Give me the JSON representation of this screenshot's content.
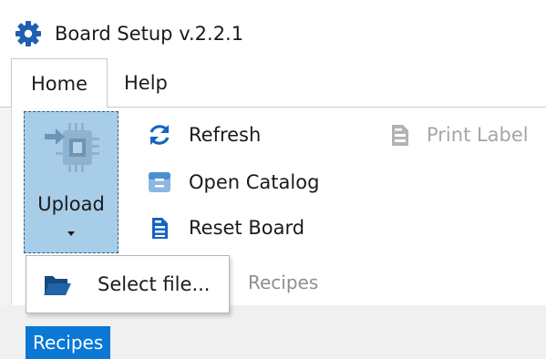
{
  "window": {
    "title": "Board Setup v.2.2.1",
    "icon": "gear-icon"
  },
  "menu": {
    "tabs": [
      {
        "label": "Home",
        "active": true
      },
      {
        "label": "Help",
        "active": false
      }
    ]
  },
  "ribbon": {
    "upload": {
      "label": "Upload",
      "icon": "chip-upload-icon",
      "pressed": true
    },
    "commands": {
      "refresh": {
        "label": "Refresh",
        "icon": "refresh-icon",
        "enabled": true
      },
      "open_catalog": {
        "label": "Open Catalog",
        "icon": "catalog-icon",
        "enabled": true
      },
      "reset_board": {
        "label": "Reset Board",
        "icon": "reset-document-icon",
        "enabled": true
      },
      "print_label": {
        "label": "Print Label",
        "icon": "print-label-icon",
        "enabled": false
      }
    },
    "group_label": "Recipes"
  },
  "upload_menu": {
    "items": [
      {
        "label": "Select file...",
        "icon": "folder-open-icon"
      }
    ]
  },
  "bottom": {
    "recipes_tag": "Recipes"
  },
  "colors": {
    "accent": "#0a78d4",
    "upload_pressed_bg": "#a8cde9",
    "icon_blue": "#1564c0",
    "disabled": "#a6a6a6"
  }
}
